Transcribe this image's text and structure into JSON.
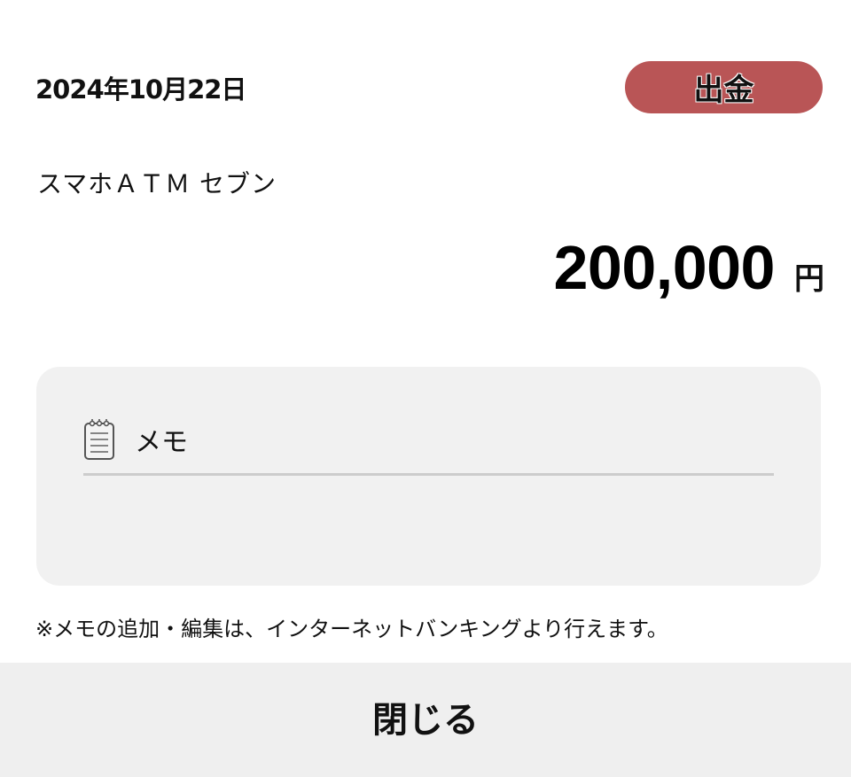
{
  "transaction": {
    "date": "2024年10月22日",
    "type_badge": "出金",
    "description": "スマホＡＴＭ セブン",
    "amount": "200,000",
    "currency_unit": "円"
  },
  "memo": {
    "label": "メモ",
    "icon": "notepad-icon",
    "value": ""
  },
  "note": "※メモの追加・編集は、インターネットバンキングより行えます。",
  "footer": {
    "close_label": "閉じる"
  },
  "colors": {
    "badge_background": "#b95556",
    "memo_background": "#f1f1f1",
    "footer_background": "#efefef"
  }
}
